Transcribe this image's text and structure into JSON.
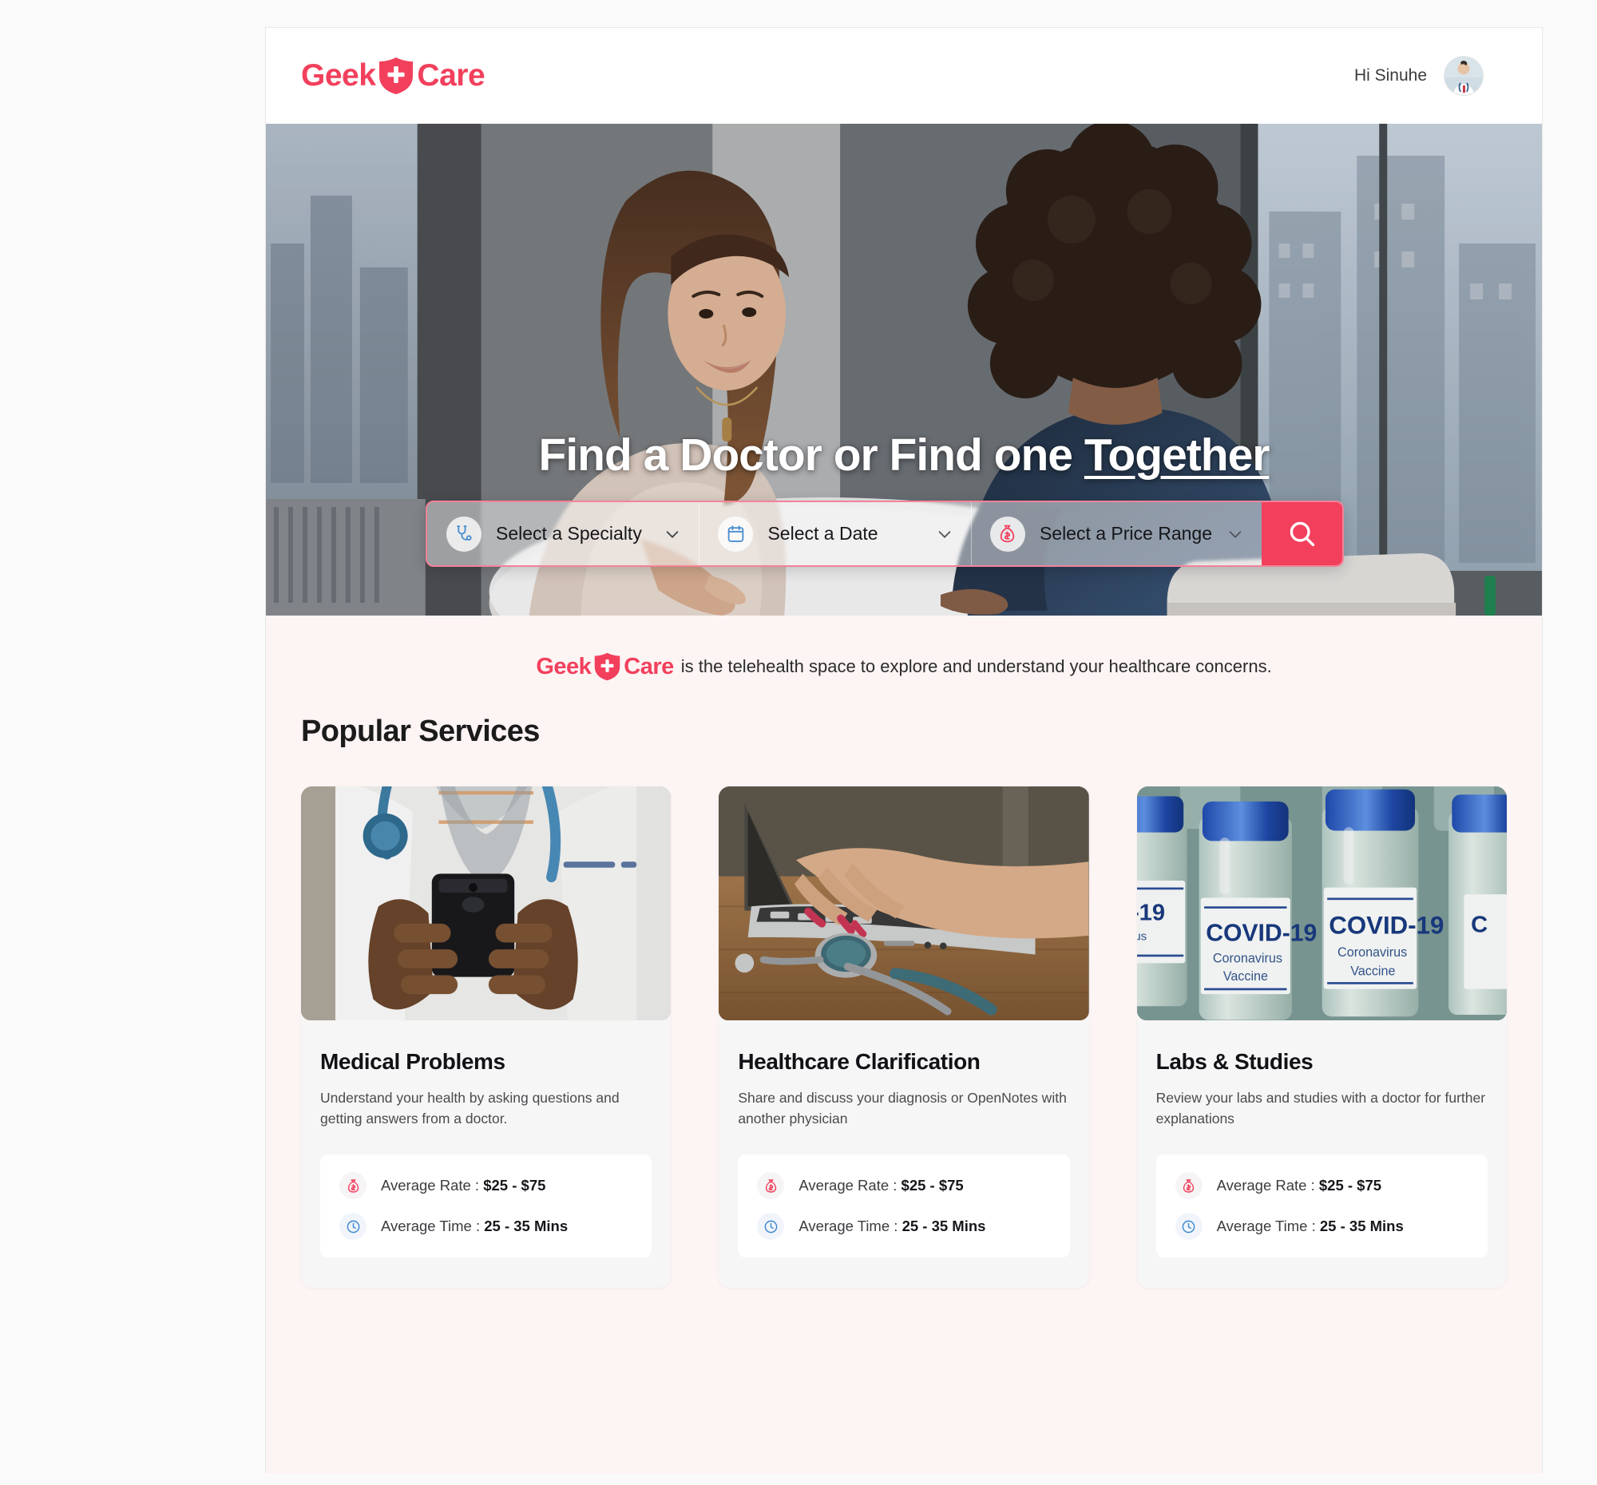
{
  "header": {
    "brand": {
      "part1": "Geek",
      "part2": "Care",
      "icon": "shield-plus-icon",
      "color": "#f2405c"
    },
    "greeting": "Hi Sinuhe",
    "avatar_alt": "doctor-avatar"
  },
  "hero": {
    "title_main": "Find a Doctor or Find one ",
    "title_underlined": "Together",
    "image_alt": "two-women-in-conversation-at-office-table",
    "search": {
      "fields": [
        {
          "icon": "stethoscope-icon",
          "label": "Select a Specialty",
          "caret": "chevron-down-icon"
        },
        {
          "icon": "calendar-icon",
          "label": "Select a Date",
          "caret": "chevron-down-icon"
        },
        {
          "icon": "money-bag-icon",
          "label": "Select a Price Range",
          "caret": "chevron-down-icon"
        }
      ],
      "button_icon": "search-icon",
      "button_color": "#f2405c"
    }
  },
  "tagline": {
    "brand_part1": "Geek",
    "brand_part2": "Care",
    "text": "is the telehealth space to explore and understand your healthcare concerns."
  },
  "services": {
    "heading": "Popular Services",
    "cards": [
      {
        "title": "Medical Problems",
        "description": "Understand your health by asking questions and getting answers from a doctor.",
        "image_alt": "doctor-holding-smartphone",
        "stats": [
          {
            "icon": "money-bag-icon",
            "label": "Average Rate : ",
            "value": "$25 - $75"
          },
          {
            "icon": "clock-icon",
            "label": "Average Time : ",
            "value": "25 - 35 Mins"
          }
        ]
      },
      {
        "title": "Healthcare Clarification",
        "description": "Share and discuss your diagnosis or OpenNotes with another physician",
        "image_alt": "hands-typing-on-laptop-with-stethoscope",
        "stats": [
          {
            "icon": "money-bag-icon",
            "label": "Average Rate : ",
            "value": "$25 - $75"
          },
          {
            "icon": "clock-icon",
            "label": "Average Time : ",
            "value": "25 - 35 Mins"
          }
        ]
      },
      {
        "title": "Labs & Studies",
        "description": "Review your labs and studies with a doctor for further explanations",
        "image_alt": "covid-19-coronavirus-vaccine-vials",
        "vial_label_top": "COVID-19",
        "vial_label_mid": "Coronavirus",
        "vial_label_bot": "Vaccine",
        "stats": [
          {
            "icon": "money-bag-icon",
            "label": "Average Rate : ",
            "value": "$25 - $75"
          },
          {
            "icon": "clock-icon",
            "label": "Average Time : ",
            "value": "25 - 35 Mins"
          }
        ]
      }
    ]
  }
}
